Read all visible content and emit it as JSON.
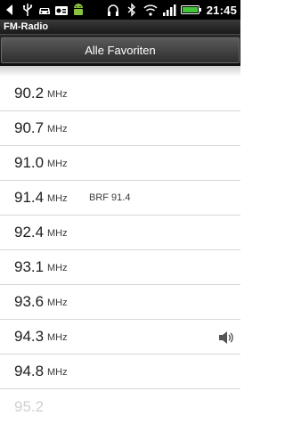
{
  "statusbar": {
    "left_icons": [
      "back-icon",
      "usb-icon",
      "car-icon",
      "radio-icon",
      "android-icon"
    ],
    "right_icons": [
      "headset-icon",
      "bluetooth-icon",
      "wifi-icon",
      "signal-icon",
      "battery-icon"
    ],
    "time": "21:45"
  },
  "app": {
    "title": "FM-Radio"
  },
  "header": {
    "tab_label": "Alle Favoriten"
  },
  "stations": [
    {
      "freq": "90.2",
      "unit": "MHz",
      "name": "",
      "playing": false
    },
    {
      "freq": "90.7",
      "unit": "MHz",
      "name": "",
      "playing": false
    },
    {
      "freq": "91.0",
      "unit": "MHz",
      "name": "",
      "playing": false
    },
    {
      "freq": "91.4",
      "unit": "MHz",
      "name": "BRF 91.4",
      "playing": false
    },
    {
      "freq": "92.4",
      "unit": "MHz",
      "name": "",
      "playing": false
    },
    {
      "freq": "93.1",
      "unit": "MHz",
      "name": "",
      "playing": false
    },
    {
      "freq": "93.6",
      "unit": "MHz",
      "name": "",
      "playing": false
    },
    {
      "freq": "94.3",
      "unit": "MHz",
      "name": "",
      "playing": true
    },
    {
      "freq": "94.8",
      "unit": "MHz",
      "name": "",
      "playing": false
    },
    {
      "freq": "95.2",
      "unit": "",
      "name": "",
      "playing": false
    }
  ],
  "colors": {
    "accent_battery": "#43c43a",
    "statusbar_bg": "#000000"
  }
}
